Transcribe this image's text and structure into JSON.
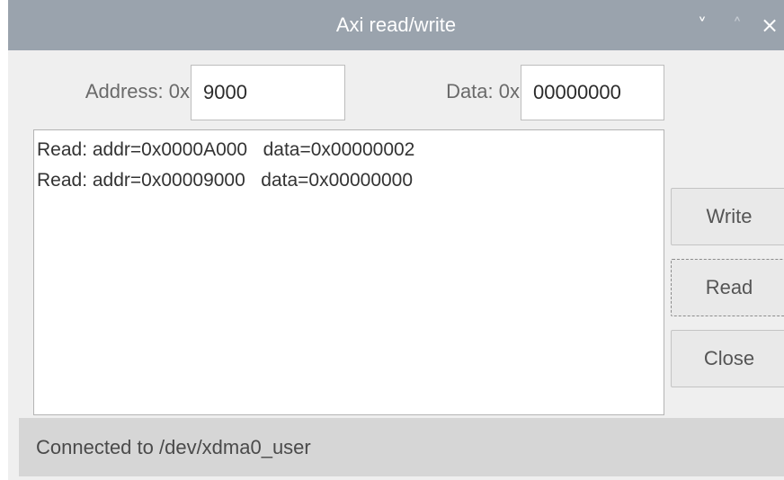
{
  "window": {
    "title": "Axi read/write",
    "controls": {
      "minimize_glyph": "˅",
      "maximize_glyph": "˄",
      "close_glyph": "×"
    }
  },
  "form": {
    "address_label": "Address: 0x",
    "address_value": "9000",
    "data_label": "Data: 0x",
    "data_value": "00000000"
  },
  "log": {
    "lines": [
      "Read: addr=0x0000A000   data=0x00000002",
      "Read: addr=0x00009000   data=0x00000000"
    ]
  },
  "buttons": {
    "write_label": "Write",
    "read_label": "Read",
    "close_label": "Close"
  },
  "status": {
    "text": "Connected to /dev/xdma0_user"
  },
  "colors": {
    "titlebar": "#9aa3ad",
    "window_bg": "#efefef",
    "statusbar": "#d6d6d6"
  }
}
